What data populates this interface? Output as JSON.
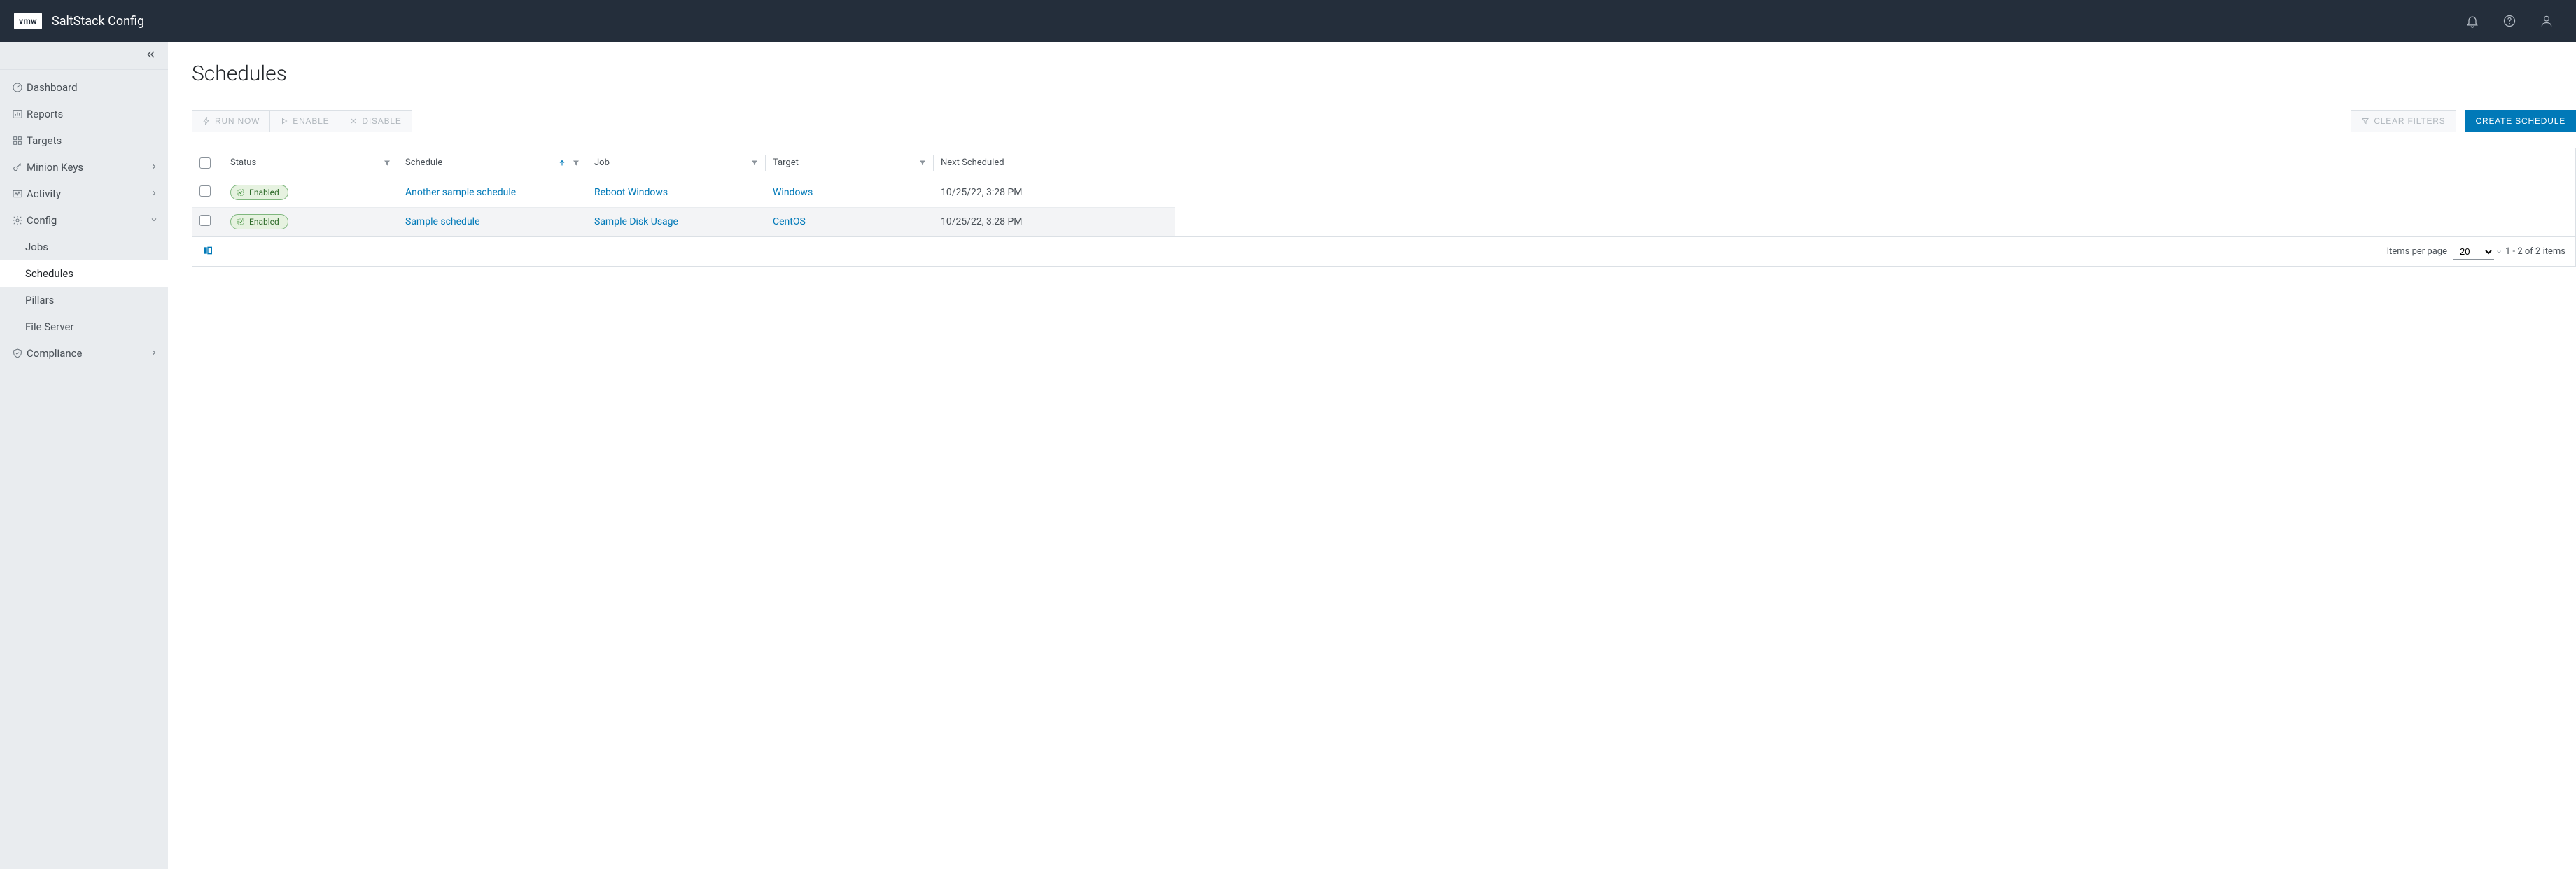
{
  "header": {
    "logo_text": "vmw",
    "product_name": "SaltStack Config"
  },
  "sidebar": {
    "items": [
      {
        "label": "Dashboard",
        "icon": "gauge",
        "expandable": false
      },
      {
        "label": "Reports",
        "icon": "bar-chart",
        "expandable": false
      },
      {
        "label": "Targets",
        "icon": "grid",
        "expandable": false
      },
      {
        "label": "Minion Keys",
        "icon": "key",
        "expandable": true,
        "expanded": false
      },
      {
        "label": "Activity",
        "icon": "activity",
        "expandable": true,
        "expanded": false
      },
      {
        "label": "Config",
        "icon": "gear",
        "expandable": true,
        "expanded": true,
        "sub": [
          {
            "label": "Jobs",
            "active": false
          },
          {
            "label": "Schedules",
            "active": true
          },
          {
            "label": "Pillars",
            "active": false
          },
          {
            "label": "File Server",
            "active": false
          }
        ]
      },
      {
        "label": "Compliance",
        "icon": "shield",
        "expandable": true,
        "expanded": false
      }
    ]
  },
  "page": {
    "title": "Schedules"
  },
  "toolbar": {
    "run_now": "Run Now",
    "enable": "Enable",
    "disable": "Disable",
    "clear": "Clear Filters",
    "create": "Create Schedule"
  },
  "table": {
    "columns": {
      "status": "Status",
      "schedule": "Schedule",
      "job": "Job",
      "target": "Target",
      "next": "Next Scheduled"
    },
    "rows": [
      {
        "status": "Enabled",
        "schedule": "Another sample schedule",
        "job": "Reboot Windows",
        "target": "Windows",
        "next": "10/25/22, 3:28 PM"
      },
      {
        "status": "Enabled",
        "schedule": "Sample schedule",
        "job": "Sample Disk Usage",
        "target": "CentOS",
        "next": "10/25/22, 3:28 PM"
      }
    ]
  },
  "footer": {
    "items_per_page_label": "Items per page",
    "items_per_page_value": "20",
    "range": "1 - 2 of 2 items"
  }
}
